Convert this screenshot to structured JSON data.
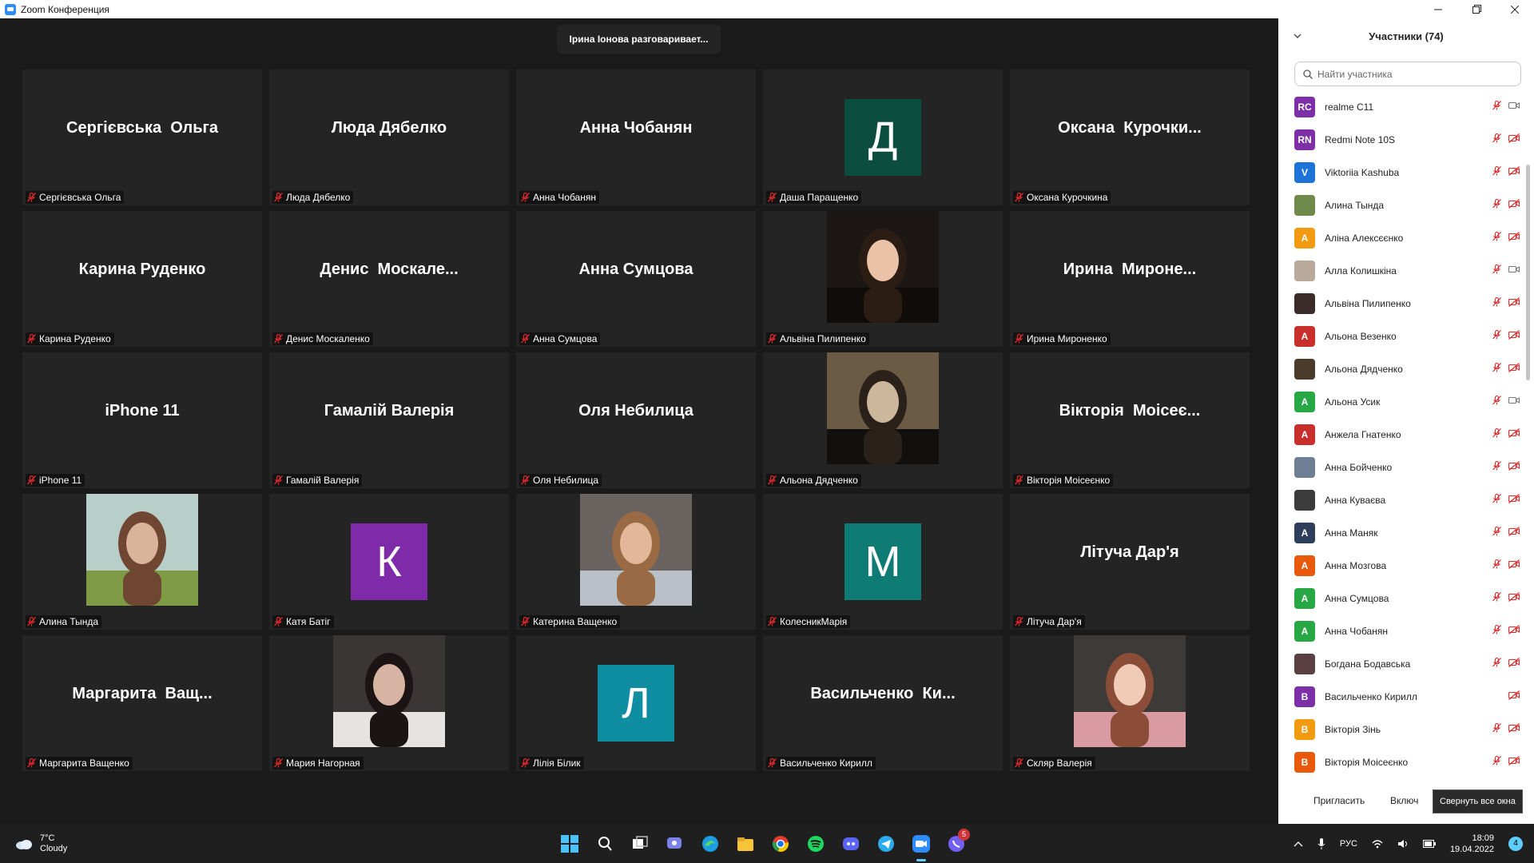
{
  "window": {
    "title": "Zoom Конференция"
  },
  "speaking_banner": "Ірина Іонова разговаривает...",
  "tiles": [
    {
      "kind": "name",
      "big": "Сергієвська  Ольга",
      "label": "Сергієвська Ольга"
    },
    {
      "kind": "name",
      "big": "Люда Дябелко",
      "label": "Люда Дябелко"
    },
    {
      "kind": "name",
      "big": "Анна Чобанян",
      "label": "Анна Чобанян"
    },
    {
      "kind": "avatar",
      "letter": "Д",
      "color": "#0b4d3f",
      "label": "Даша Паращенко"
    },
    {
      "kind": "name",
      "big": "Оксана  Курочки...",
      "label": "Оксана Курочкина"
    },
    {
      "kind": "name",
      "big": "Карина Руденко",
      "label": "Карина Руденко"
    },
    {
      "kind": "name",
      "big": "Денис  Москале...",
      "label": "Денис Москаленко"
    },
    {
      "kind": "name",
      "big": "Анна Сумцова",
      "label": "Анна Сумцова"
    },
    {
      "kind": "photo",
      "photo": "girl-portrait",
      "label": "Альвіна Пилипенко"
    },
    {
      "kind": "name",
      "big": "Ирина  Мироне...",
      "label": "Ирина Мироненко"
    },
    {
      "kind": "name",
      "big": "iPhone 11",
      "label": "iPhone 11"
    },
    {
      "kind": "name",
      "big": "Гамалій Валерія",
      "label": "Гамалій Валерія"
    },
    {
      "kind": "name",
      "big": "Оля Небилица",
      "label": "Оля Небилица"
    },
    {
      "kind": "photo",
      "photo": "forest",
      "label": "Альона Дядченко"
    },
    {
      "kind": "name",
      "big": "Вікторія  Моісеє...",
      "label": "Вікторія Моісеєнко"
    },
    {
      "kind": "photo",
      "photo": "field",
      "label": "Алина Тында"
    },
    {
      "kind": "avatar",
      "letter": "К",
      "color": "#7f2aa8",
      "label": "Катя Батіг"
    },
    {
      "kind": "photo",
      "photo": "selfie",
      "label": "Катерина Ващенко"
    },
    {
      "kind": "avatar",
      "letter": "М",
      "color": "#0e7c74",
      "label": "КолесникМарія"
    },
    {
      "kind": "name",
      "big": "Літуча Дар'я",
      "label": "Літуча Дар'я"
    },
    {
      "kind": "name",
      "big": "Маргарита  Ващ...",
      "label": "Маргарита Ващенко"
    },
    {
      "kind": "photo",
      "photo": "dark-portrait",
      "label": "Мария Нагорная"
    },
    {
      "kind": "avatar",
      "letter": "Л",
      "color": "#0f8ea1",
      "label": "Лілія Білик"
    },
    {
      "kind": "name",
      "big": "Васильченко  Ки...",
      "label": "Васильченко Кирилл"
    },
    {
      "kind": "photo",
      "photo": "pink-sweater",
      "label": "Скляр Валерія"
    }
  ],
  "panel": {
    "title": "Участники (74)",
    "search_placeholder": "Найти участника",
    "invite_label": "Пригласить",
    "unmute_label": "Включ",
    "participants": [
      {
        "initials": "RC",
        "color": "#7c2fa6",
        "name": "realme C11",
        "video": "on"
      },
      {
        "initials": "RN",
        "color": "#7c2fa6",
        "name": "Redmi Note 10S",
        "video": "off"
      },
      {
        "initials": "V",
        "color": "#1e73d8",
        "name": "Viktoriia Kashuba",
        "video": "off"
      },
      {
        "initials": "",
        "color": "#6f8a4a",
        "name": "Алина Тында",
        "video": "off"
      },
      {
        "initials": "А",
        "color": "#f29b11",
        "name": "Аліна Алексєєнко",
        "video": "off"
      },
      {
        "initials": "",
        "color": "#b8a99a",
        "name": "Алла Колишкіна",
        "video": "on"
      },
      {
        "initials": "",
        "color": "#3a2a2a",
        "name": "Альвіна Пилипенко",
        "video": "off"
      },
      {
        "initials": "А",
        "color": "#c9302c",
        "name": "Альона Везенко",
        "video": "off"
      },
      {
        "initials": "",
        "color": "#4a3a2a",
        "name": "Альона Дядченко",
        "video": "off"
      },
      {
        "initials": "А",
        "color": "#27a844",
        "name": "Альона Усик",
        "video": "on"
      },
      {
        "initials": "А",
        "color": "#c9302c",
        "name": "Анжела Гнатенко",
        "video": "off"
      },
      {
        "initials": "",
        "color": "#6e7f95",
        "name": "Анна Бойченко",
        "video": "off"
      },
      {
        "initials": "",
        "color": "#3b3b3b",
        "name": "Анна Куваєва",
        "video": "off"
      },
      {
        "initials": "А",
        "color": "#2c3e5c",
        "name": "Анна Маняк",
        "video": "off"
      },
      {
        "initials": "А",
        "color": "#e8590c",
        "name": "Анна Мозгова",
        "video": "off"
      },
      {
        "initials": "А",
        "color": "#27a844",
        "name": "Анна Сумцова",
        "video": "off"
      },
      {
        "initials": "А",
        "color": "#27a844",
        "name": "Анна Чобанян",
        "video": "off"
      },
      {
        "initials": "",
        "color": "#5a4040",
        "name": "Богдана Бодавська",
        "video": "off"
      },
      {
        "initials": "В",
        "color": "#7c2fa6",
        "name": "Васильченко Кирилл",
        "video": "off_only"
      },
      {
        "initials": "В",
        "color": "#f29b11",
        "name": "Вікторія Зінь",
        "video": "off"
      },
      {
        "initials": "В",
        "color": "#e8590c",
        "name": "Вікторія Моісеєнко",
        "video": "off"
      }
    ]
  },
  "tooltip": "Свернуть все окна",
  "taskbar": {
    "weather_temp": "7°C",
    "weather_desc": "Cloudy",
    "lang": "РУС",
    "time": "18:09",
    "date": "19.04.2022",
    "notifications": "4",
    "viber_badge": "5",
    "apps": [
      "windows-start",
      "search",
      "task-view",
      "teams-chat",
      "edge",
      "file-explorer",
      "chrome",
      "spotify",
      "discord",
      "telegram",
      "zoom",
      "viber"
    ]
  },
  "colors": {
    "accent": "#2d8cff",
    "mute_red": "#e02828",
    "tile_bg": "#242424",
    "stage_bg": "#1a1a1a"
  }
}
